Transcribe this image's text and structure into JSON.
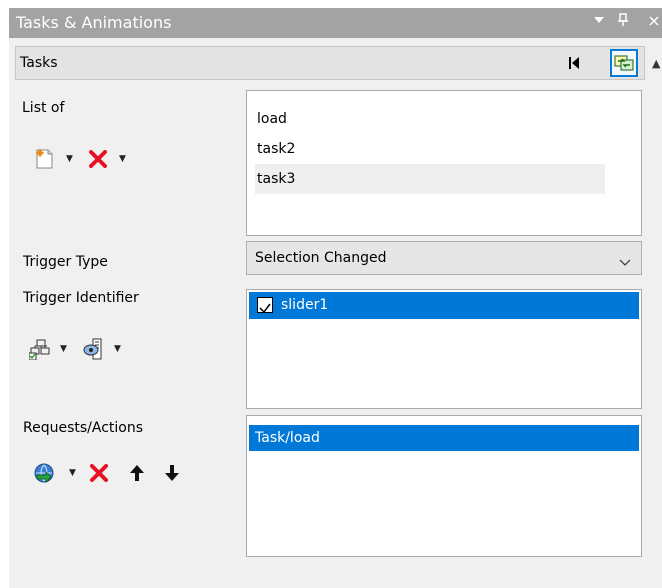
{
  "panel": {
    "title": "Tasks & Animations",
    "pin_glyph": "▾",
    "dock_glyph": "ᴨ",
    "close_glyph": "✕"
  },
  "tasks_bar": {
    "label": "Tasks",
    "collapse_icon": "collapse-left-icon",
    "sync_icon": "sync-icon"
  },
  "list_of": {
    "label": "List of",
    "items": [
      "load",
      "task2",
      "task3"
    ],
    "selected_index": 2,
    "toolbar": [
      "new-task-icon",
      "delete-icon"
    ]
  },
  "trigger_type": {
    "label": "Trigger Type",
    "value": "Selection Changed"
  },
  "trigger_identifier": {
    "label": "Trigger Identifier",
    "items": [
      {
        "label": "slider1",
        "checked": true
      }
    ],
    "toolbar": [
      "add-trigger-icon",
      "view-trigger-icon"
    ]
  },
  "requests_actions": {
    "label": "Requests/Actions",
    "items": [
      "Task/load"
    ],
    "toolbar": [
      "add-action-icon",
      "delete-icon",
      "move-up-icon",
      "move-down-icon"
    ]
  },
  "colors": {
    "titlebar": "#a3a3a3",
    "selection": "#0078d7",
    "panel_bg": "#f0f0f0",
    "focus_border": "#0a7ad6",
    "delete_red": "#e81123"
  }
}
